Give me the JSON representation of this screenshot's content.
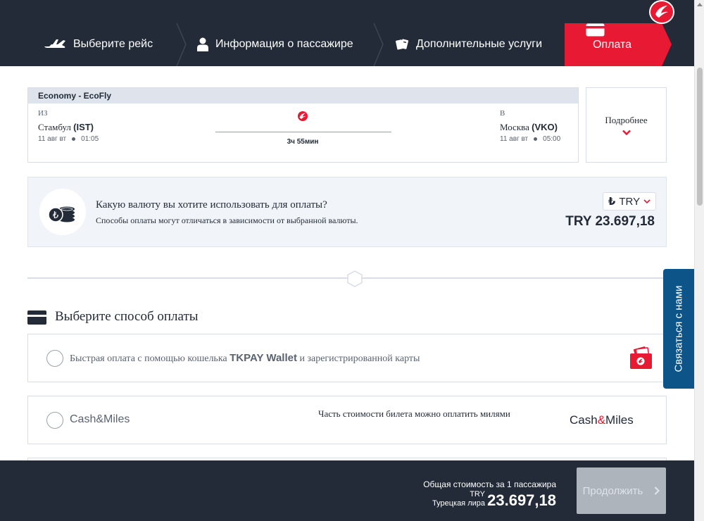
{
  "header": {
    "steps": [
      {
        "label": "Выберите рейс",
        "icon": "airplane-icon"
      },
      {
        "label": "Информация о пассажире",
        "icon": "person-icon"
      },
      {
        "label": "Дополнительные услуги",
        "icon": "tickets-icon"
      },
      {
        "label": "Оплата",
        "icon": "card-icon",
        "active": true
      }
    ],
    "logo_icon": "turkish-airlines-logo-icon"
  },
  "flight": {
    "cabin": "Economy - EcoFly",
    "from_label": "ИЗ",
    "from_city": "Стамбул",
    "from_code": "(IST)",
    "from_date": "11 авг вт",
    "from_time": "01:05",
    "to_label": "В",
    "to_city": "Москва",
    "to_code": "(VKO)",
    "to_date": "11 авг вт",
    "to_time": "05:00",
    "duration": "3ч 55мин",
    "details_label": "Подробнее"
  },
  "currency": {
    "question": "Какую валюту вы хотите использовать для оплаты?",
    "note": "Способы оплаты могут отличаться в зависимости от выбранной валюты.",
    "selected_symbol": "₺",
    "selected": "TRY",
    "total": "TRY 23.697,18"
  },
  "payment": {
    "title": "Выберите способ оплаты",
    "option1": {
      "pre": "Быстрая оплата с помощью кошелька ",
      "brand": "TKPAY Wallet",
      "post": " и зарегистрированной карты"
    },
    "option2": {
      "label": "Cash&Miles",
      "note": "Часть стоимости билета можно оплатить милями",
      "logo_a": "Cash",
      "logo_amp": "&",
      "logo_b": "Miles"
    }
  },
  "side_tab": {
    "label": "Связаться с нами"
  },
  "footer": {
    "total_note": "Общая стоимость за 1 пассажира",
    "currency_code": "TRY",
    "currency_name": "Турецкая лира",
    "amount": "23.697,18",
    "continue_label": "Продолжить"
  },
  "colors": {
    "navy": "#232b38",
    "red": "#e81932",
    "blue_tab": "#0d5489",
    "panel": "#f1f4f8",
    "disabled": "#aeb4bc"
  }
}
